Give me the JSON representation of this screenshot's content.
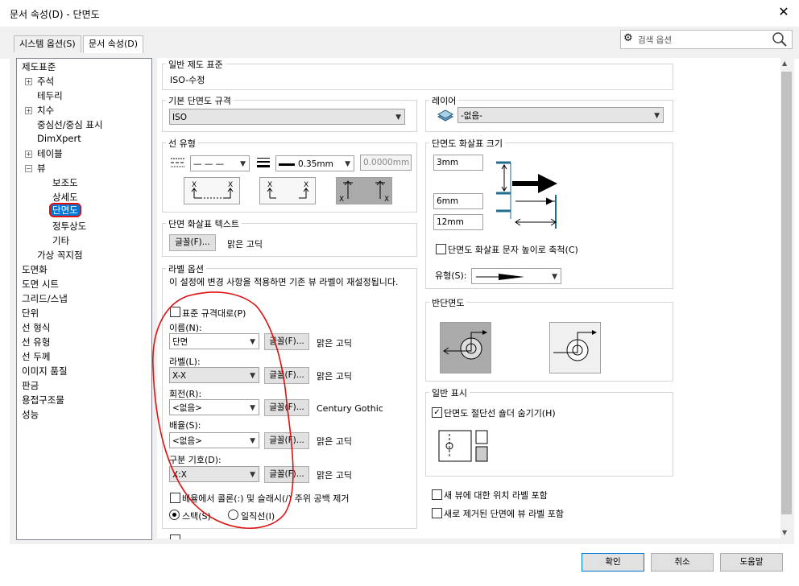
{
  "window": {
    "title": "문서 속성(D) - 단면도",
    "close_icon": "close-icon"
  },
  "tabs": [
    "시스템 옵션(S)",
    "문서 속성(D)"
  ],
  "search": {
    "placeholder": "검색 옵션"
  },
  "tree": {
    "items": [
      "제도표준",
      "주석",
      "테두리",
      "치수",
      "중심선/중심 표시",
      "DimXpert",
      "테이블",
      "뷰",
      "보조도",
      "상세도",
      "단면도",
      "정투상도",
      "기타",
      "가상 꼭지점",
      "도면화",
      "도면 시트",
      "그리드/스냅",
      "단위",
      "선 형식",
      "선 유형",
      "선 두께",
      "이미지 품질",
      "판금",
      "용접구조물",
      "성능"
    ]
  },
  "general_standard": {
    "title": "일반 제도 표준",
    "value": "ISO-수정"
  },
  "base_standard": {
    "title": "기본 단면도 규격",
    "value": "ISO"
  },
  "layer": {
    "title": "레이어",
    "value": "-없음-"
  },
  "line_type": {
    "title": "선 유형",
    "style_value": "— — —",
    "weight_value": "0.35mm",
    "thickness_value": "0.0000mm"
  },
  "arrow_size": {
    "title": "단면도 화살표 크기",
    "v1": "3mm",
    "v2": "6mm",
    "v3": "12mm",
    "scale_label": "단면도 화살표 문자 높이로 축척(C)",
    "style_label": "유형(S):"
  },
  "arrow_text": {
    "title": "단면 화살표 텍스트",
    "font_button": "글꼴(F)...",
    "font_name": "맑은 고딕"
  },
  "label_options": {
    "title": "라벨 옵션",
    "note": "이 설정에 변경 사항을 적용하면 기존 뷰 라벨이 재설정됩니다.",
    "standard_label": "표준 규격대로(P)",
    "name_label": "이름(N):",
    "name_value": "단면",
    "name_font": "맑은 고딕",
    "label_label": "라벨(L):",
    "label_value": "X-X",
    "label_font": "맑은 고딕",
    "rotate_label": "회전(R):",
    "rotate_value": "<없음>",
    "rotate_font": "Century Gothic",
    "scale_label": "배율(S):",
    "scale_value": "<없음>",
    "scale_font": "맑은 고딕",
    "delim_label": "구분 기호(D):",
    "delim_value": "X:X",
    "delim_font": "맑은 고딕",
    "font_button": "글꼴(F)...",
    "remove_colon_label": "배율에서 콜론(:) 및 슬래시(/) 주위 공백 제거",
    "stack_label": "스택(S)",
    "inline_label": "일직선(I)"
  },
  "half_section": {
    "title": "반단면도"
  },
  "general_display": {
    "title": "일반 표시",
    "hide_label": "단면도 절단선 숄더 숨기기(H)"
  },
  "bottom_checks": [
    "새 뷰에 대한 위치 라벨 포함",
    "새로 제거된 단면에 뷰 라벨 포함"
  ],
  "footer": {
    "ok": "확인",
    "cancel": "취소",
    "help": "도움말"
  },
  "colors": {
    "selection": "#0078d7",
    "annotation": "#e01010",
    "accent": "#1f6e8c"
  }
}
